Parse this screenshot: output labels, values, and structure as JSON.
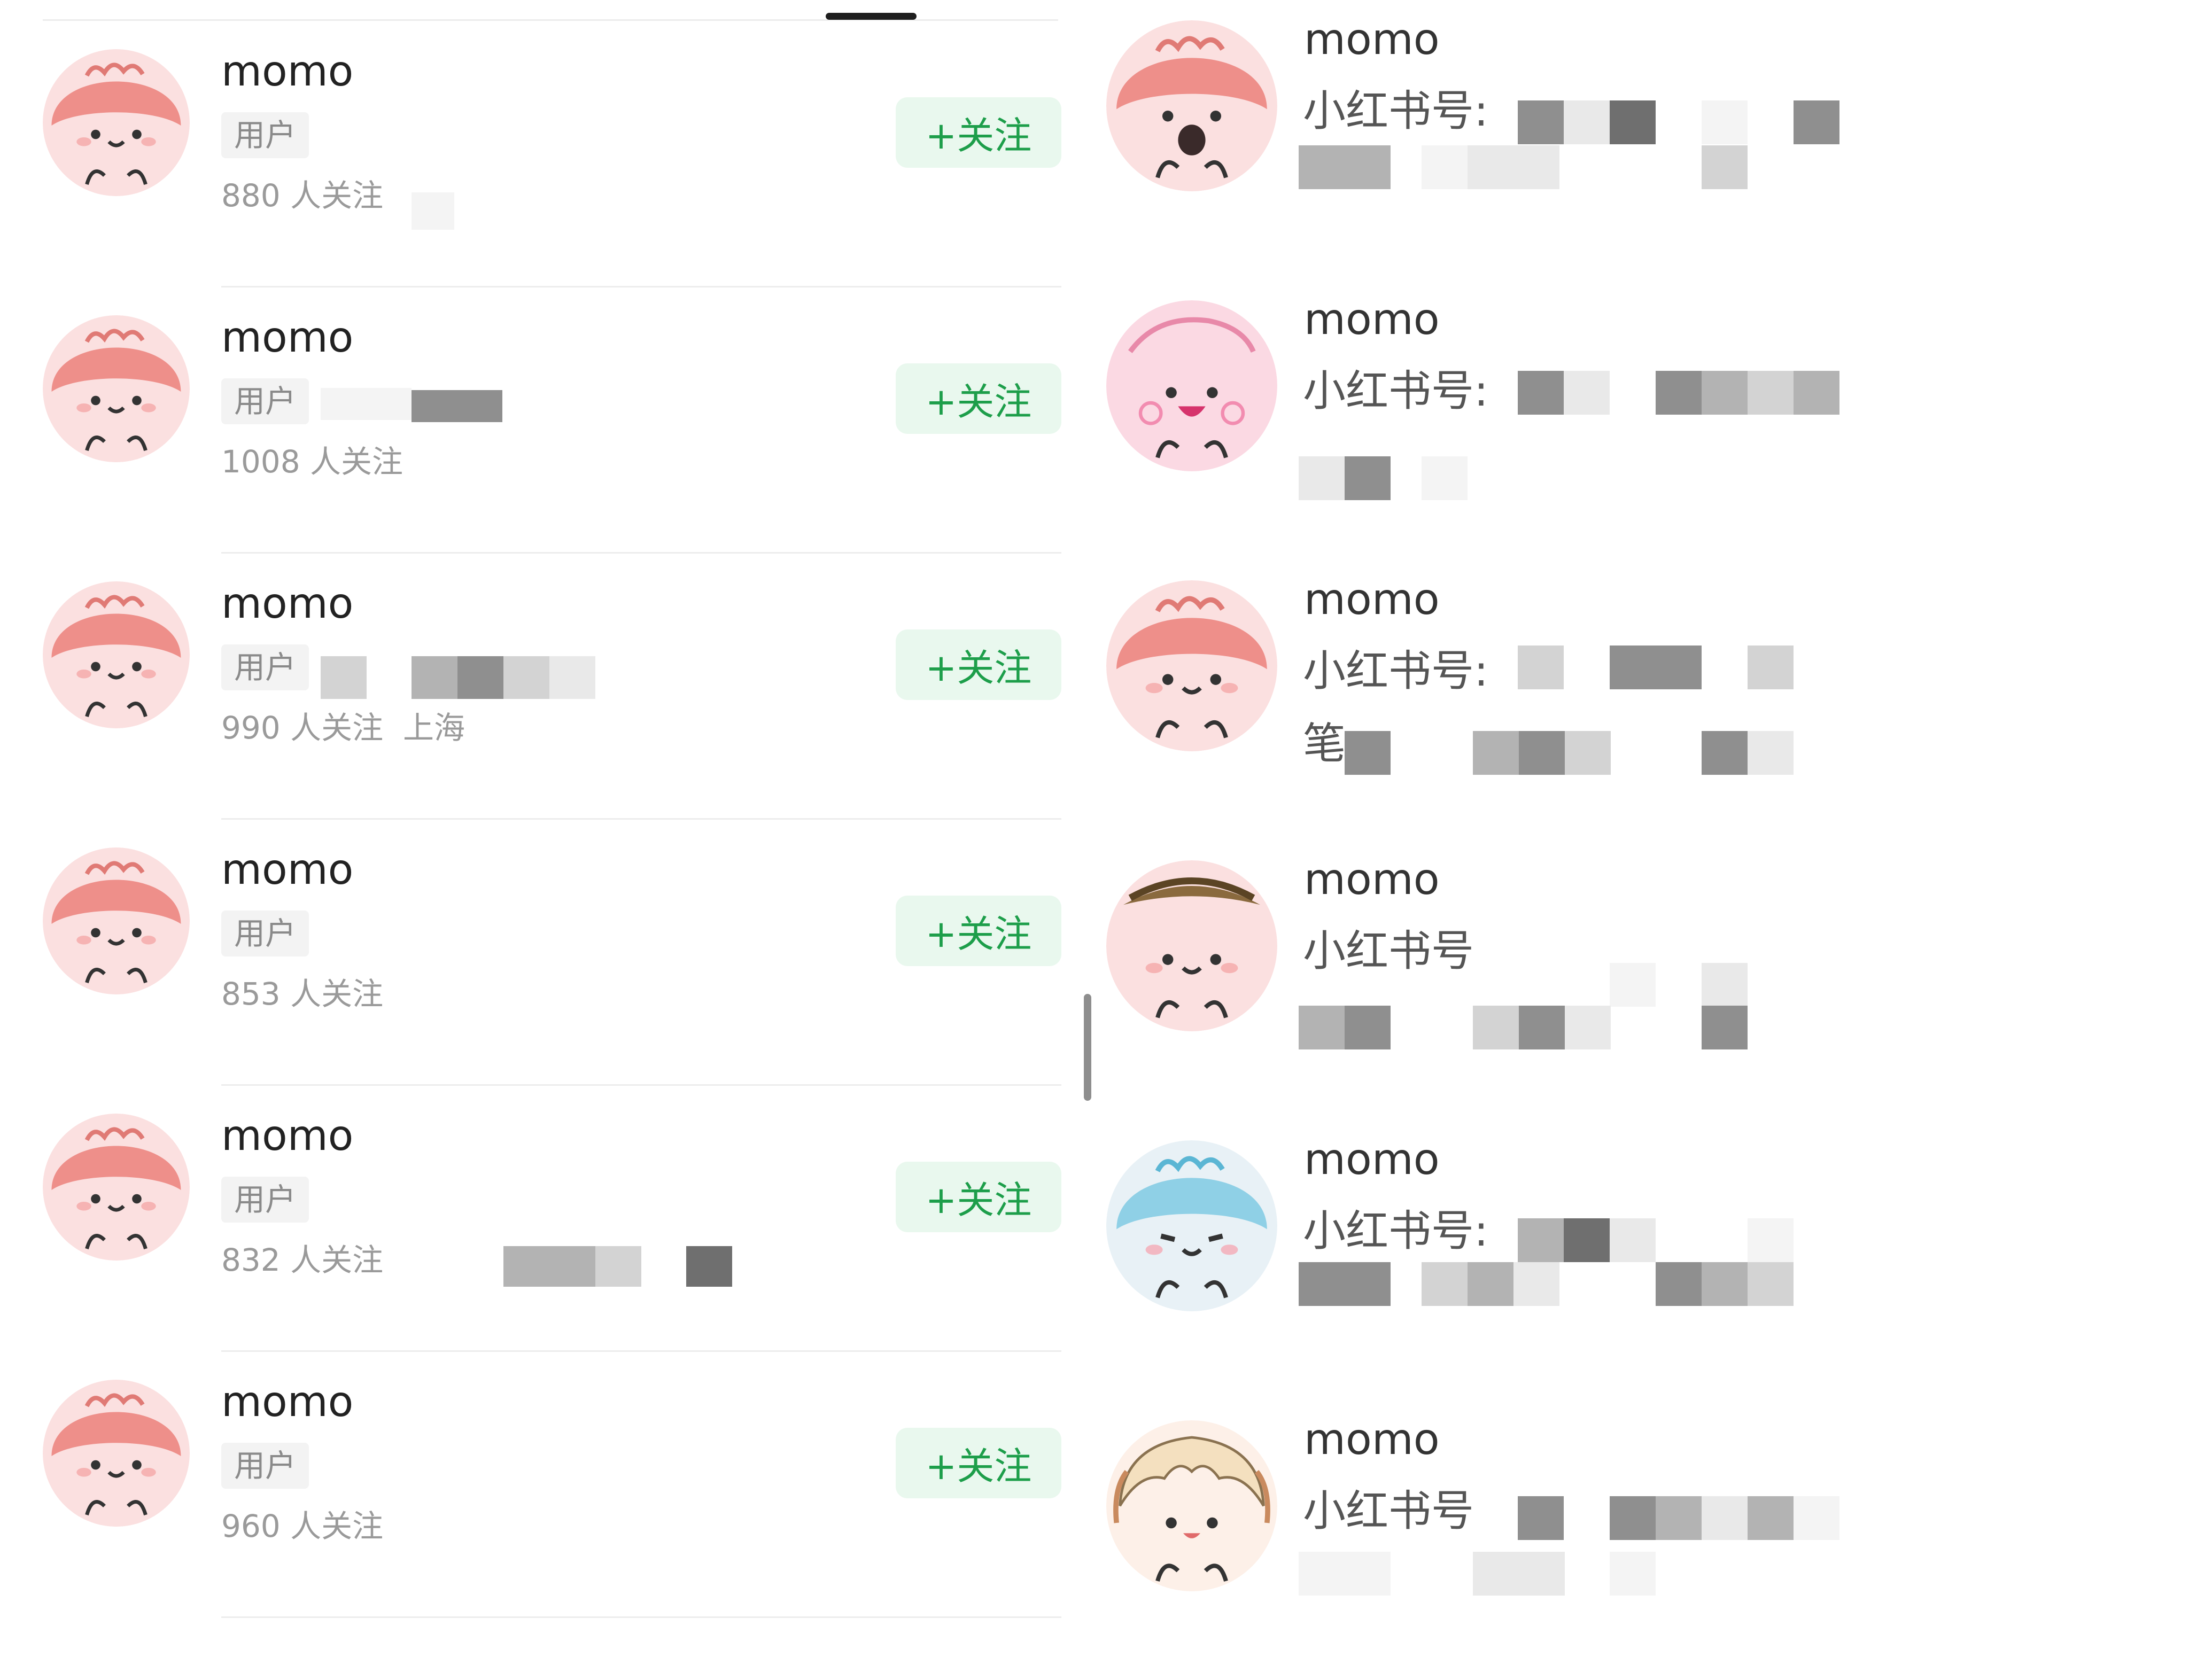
{
  "left_list": {
    "items": [
      {
        "name": "momo",
        "tag": "用户",
        "fans": "880 人关注",
        "location": "",
        "follow": "+关注"
      },
      {
        "name": "momo",
        "tag": "用户",
        "fans": "1008 人关注",
        "location": "",
        "follow": "+关注"
      },
      {
        "name": "momo",
        "tag": "用户",
        "fans": "990 人关注",
        "location": "上海",
        "follow": "+关注"
      },
      {
        "name": "momo",
        "tag": "用户",
        "fans": "853 人关注",
        "location": "",
        "follow": "+关注"
      },
      {
        "name": "momo",
        "tag": "用户",
        "fans": "832 人关注",
        "location": "",
        "follow": "+关注"
      },
      {
        "name": "momo",
        "tag": "用户",
        "fans": "960 人关注",
        "location": "",
        "follow": "+关注"
      }
    ]
  },
  "right_list": {
    "items": [
      {
        "name": "momo",
        "id_label": "小红书号:",
        "extra": ""
      },
      {
        "name": "momo",
        "id_label": "小红书号:",
        "extra": ""
      },
      {
        "name": "momo",
        "id_label": "小红书号:",
        "extra": "笔"
      },
      {
        "name": "momo",
        "id_label": "小红书号",
        "extra": ""
      },
      {
        "name": "momo",
        "id_label": "小红书号:",
        "extra": ""
      },
      {
        "name": "momo",
        "id_label": "小红书号",
        "extra": ""
      }
    ]
  },
  "colors": {
    "follow_green": "#1d9e4a",
    "follow_bg": "#e9f8ee",
    "avatar_pink": "#f6c3c3",
    "avatar_cap": "#ee8f8a"
  }
}
